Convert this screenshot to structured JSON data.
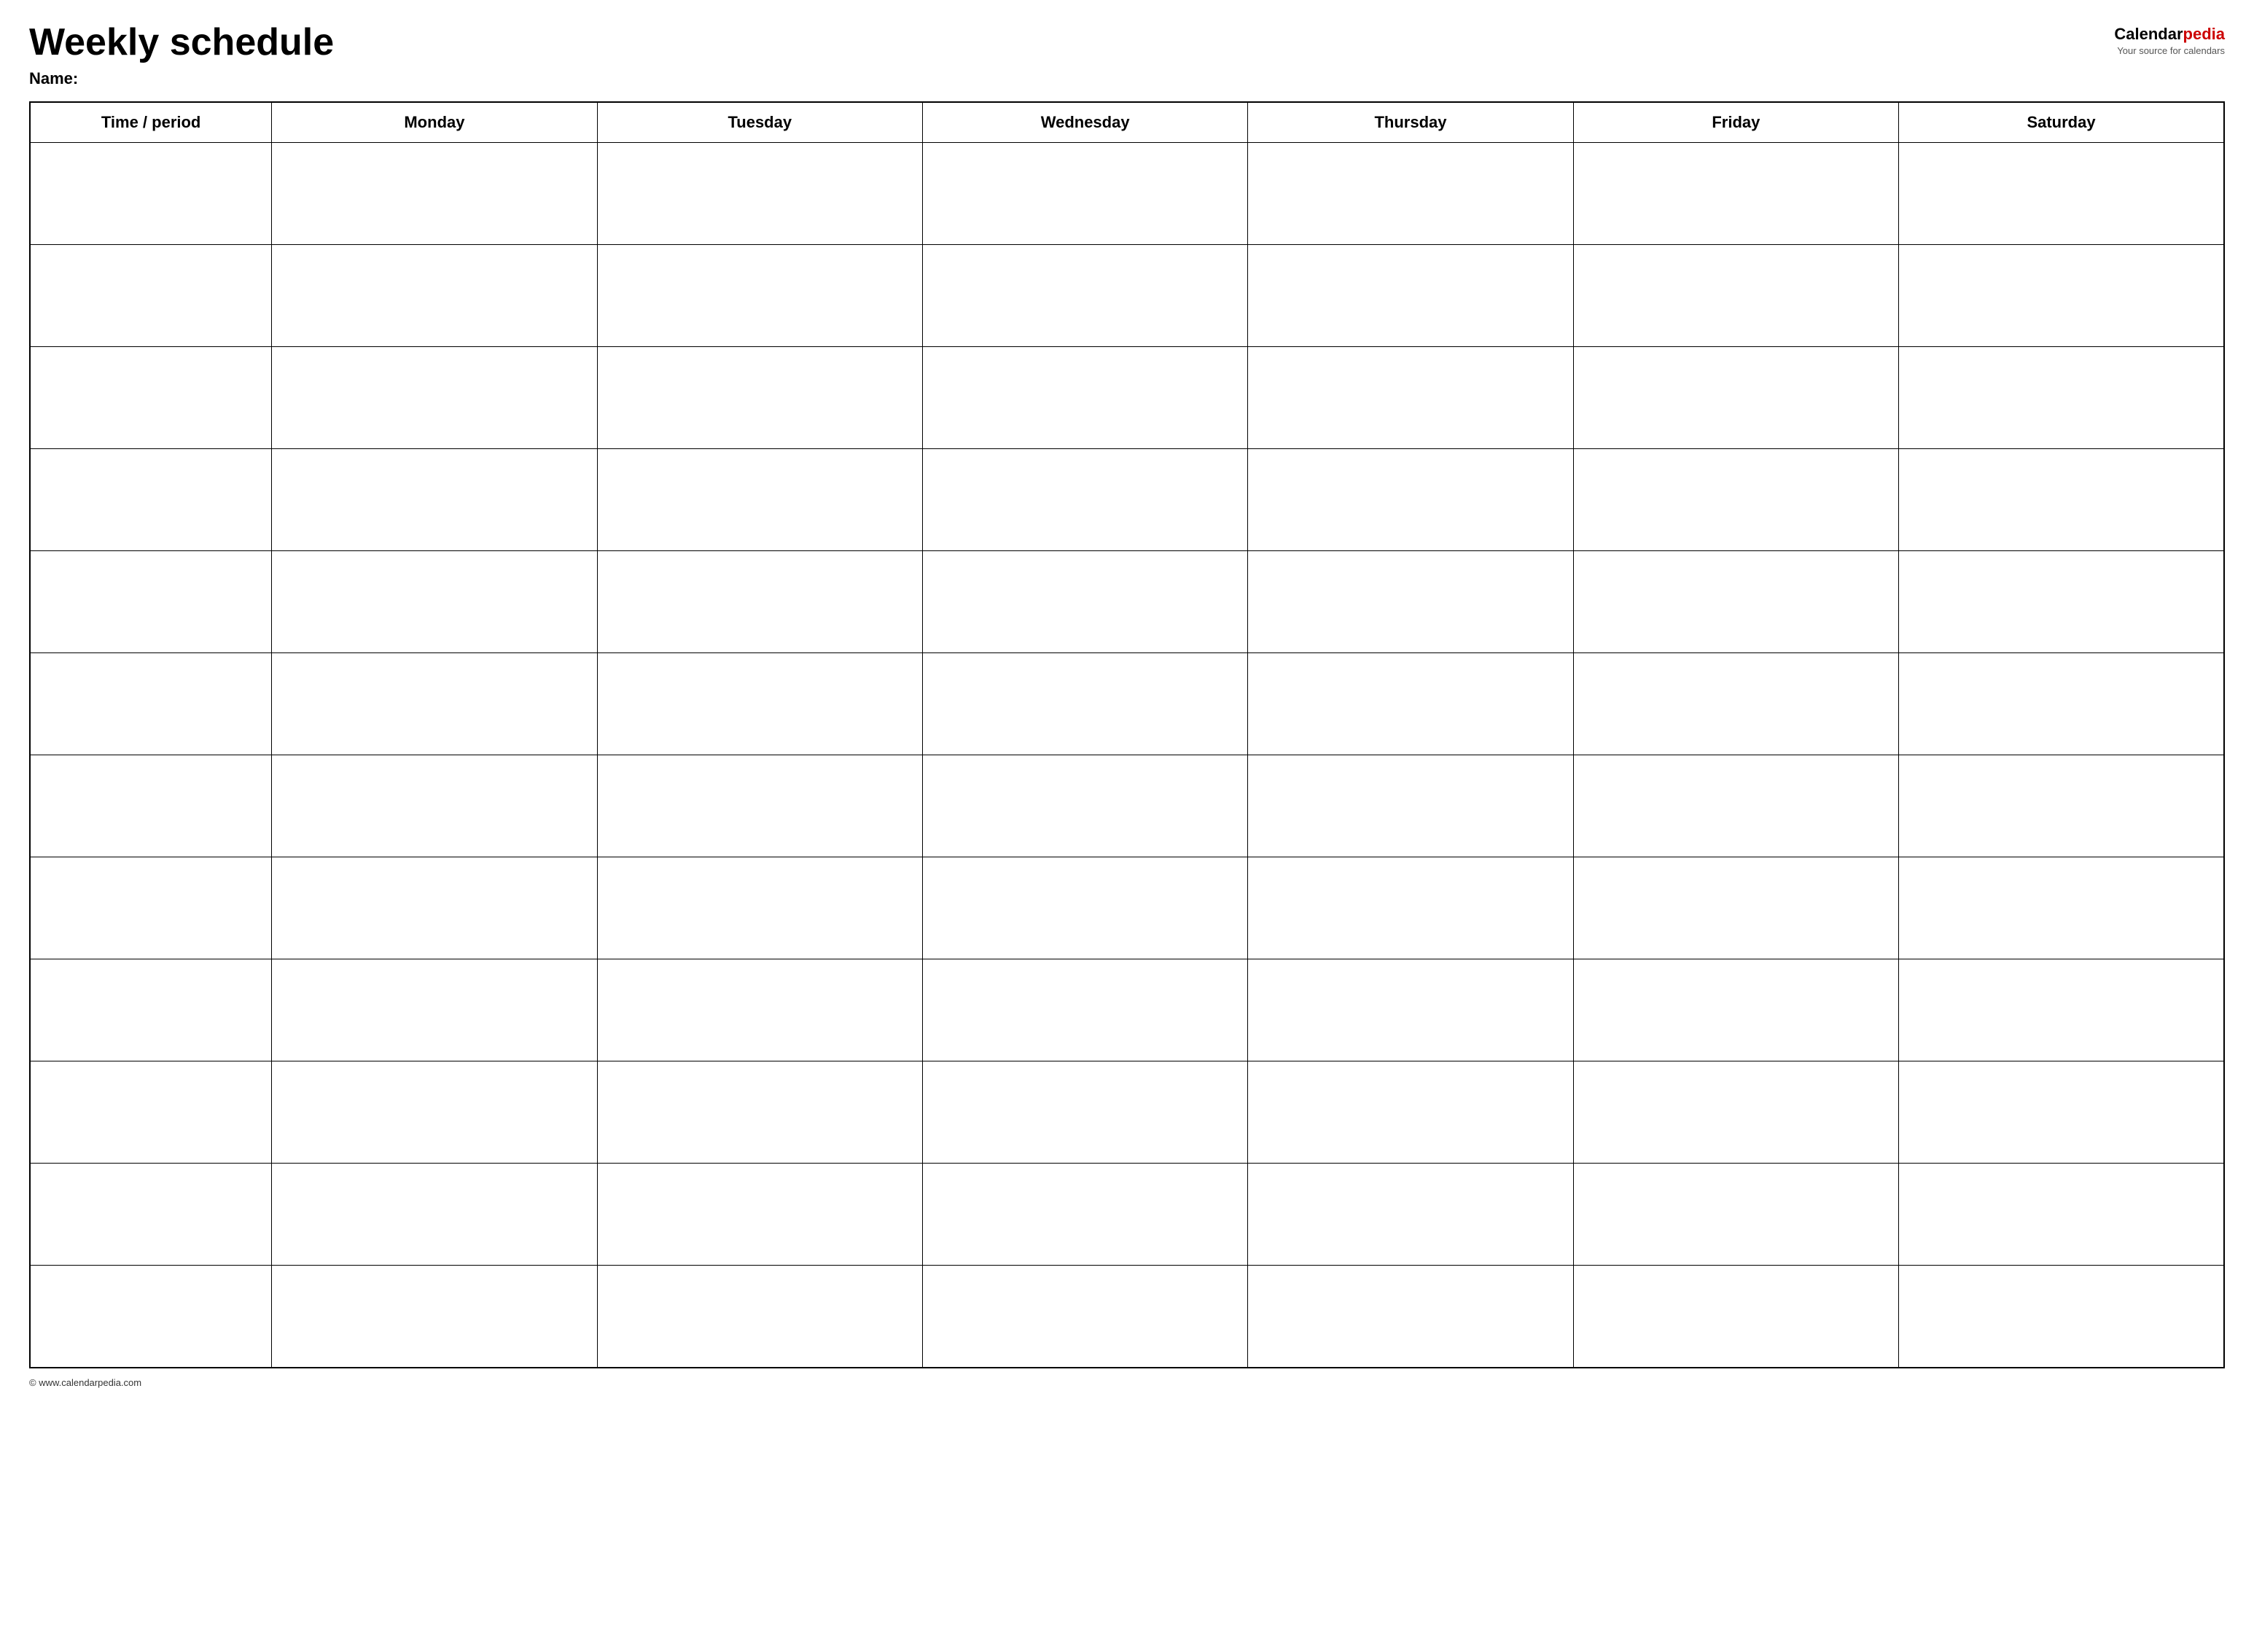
{
  "header": {
    "title": "Weekly schedule",
    "name_label": "Name:",
    "logo": {
      "calendar_part": "Calendar",
      "pedia_part": "pedia",
      "tagline": "Your source for calendars"
    }
  },
  "table": {
    "columns": [
      {
        "key": "time",
        "label": "Time / period"
      },
      {
        "key": "monday",
        "label": "Monday"
      },
      {
        "key": "tuesday",
        "label": "Tuesday"
      },
      {
        "key": "wednesday",
        "label": "Wednesday"
      },
      {
        "key": "thursday",
        "label": "Thursday"
      },
      {
        "key": "friday",
        "label": "Friday"
      },
      {
        "key": "saturday",
        "label": "Saturday"
      }
    ],
    "row_count": 12
  },
  "footer": {
    "text": "© www.calendarpedia.com"
  }
}
